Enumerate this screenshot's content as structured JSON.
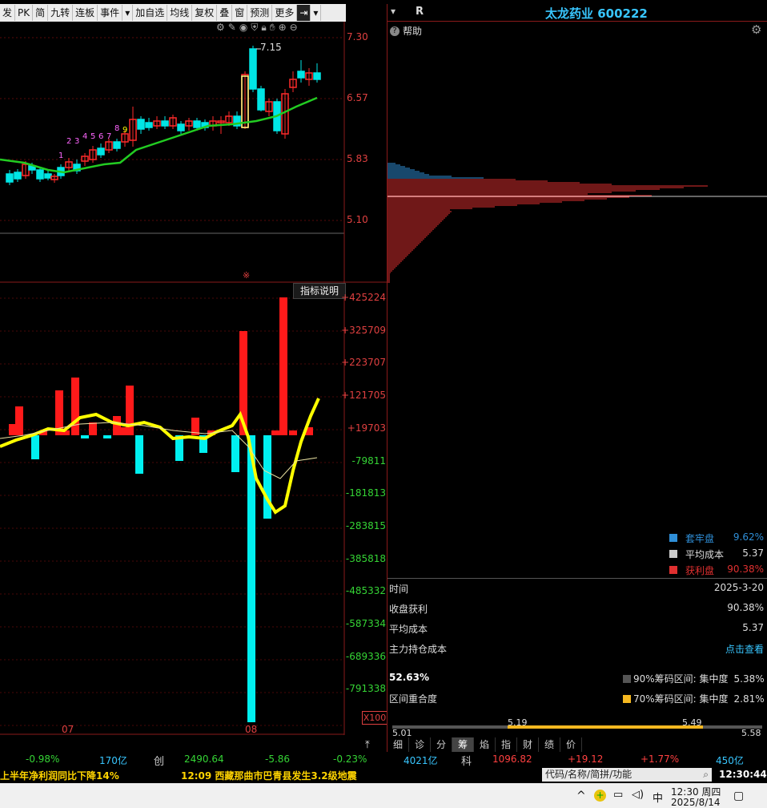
{
  "toolbar": {
    "items": [
      "发",
      "PK",
      "简",
      "九转",
      "连板",
      "事件",
      "加自选",
      "均线",
      "复权",
      "叠",
      "窗",
      "预测",
      "更多"
    ],
    "icons": [
      "gear-icon",
      "pen-icon",
      "eye-icon",
      "shield-icon",
      "lock-icon",
      "hand-icon",
      "plus-icon",
      "minus-icon"
    ]
  },
  "kline": {
    "price_axis": [
      "7.30",
      "6.57",
      "5.83",
      "5.10"
    ],
    "high_label": "7.15",
    "count_marks": [
      "1",
      "2",
      "3",
      "4",
      "5",
      "6",
      "7",
      "8",
      "9"
    ],
    "colors": {
      "up": "#ff2a2a",
      "down": "#00e5e5",
      "ma": "#22cc22"
    }
  },
  "indicator": {
    "title_button": "指标说明",
    "axis": [
      "+425224",
      "+325709",
      "+223707",
      "+121705",
      "+19703",
      "-79811",
      "-181813",
      "-283815",
      "-385818",
      "-485332",
      "-587334",
      "-689336",
      "-791338"
    ],
    "scale": "X100",
    "date_ticks": [
      "07",
      "08"
    ]
  },
  "right": {
    "r_label": "R",
    "stock_name": "太龙药业 600222",
    "help": "帮助",
    "legend": [
      {
        "name": "套牢盘",
        "value": "9.62%",
        "color": "#2f8fd8"
      },
      {
        "name": "平均成本",
        "value": "5.37",
        "color": "#cccccc"
      },
      {
        "name": "获利盘",
        "value": "90.38%",
        "color": "#e03030"
      }
    ],
    "info": [
      {
        "label": "时间",
        "value": "2025-3-20"
      },
      {
        "label": "收盘获利",
        "value": "90.38%"
      },
      {
        "label": "平均成本",
        "value": "5.37"
      },
      {
        "label": "主力持仓成本",
        "value": "点击查看"
      }
    ],
    "overlap_pct": "52.63%",
    "overlap_label": "区间重合度",
    "range90": {
      "label": "90%筹码区间: 集中度",
      "value": "5.38%"
    },
    "range70": {
      "label": "70%筹码区间: 集中度",
      "value": "2.81%"
    },
    "bar_labels": [
      "5.19",
      "5.49"
    ],
    "scale": [
      "5.01",
      "5.58"
    ],
    "tabs": [
      "细",
      "诊",
      "分",
      "筹",
      "焰",
      "指",
      "财",
      "绩",
      "价"
    ],
    "active_tab": "筹"
  },
  "status": {
    "sh_pct": "-0.98%",
    "sh_amt": "170亿",
    "cy_label": "创",
    "cy_val": "2490.64",
    "cy_chg": "-5.86",
    "cy_pct": "-0.23%",
    "cy_amt": "4021亿",
    "kc_label": "科",
    "kc_val": "1096.82",
    "kc_chg": "+19.12",
    "kc_pct": "+1.77%",
    "kc_amt": "450亿"
  },
  "ticker": {
    "news1": "上半年净利润同比下降14%",
    "news2": "12:09 西藏那曲市巴青县发生3.2级地震",
    "search_placeholder": "代码/名称/简拼/功能",
    "clock": "12:30:44"
  },
  "taskbar": {
    "ime": "中",
    "time": "12:30 周四",
    "date": "2025/8/14"
  }
}
